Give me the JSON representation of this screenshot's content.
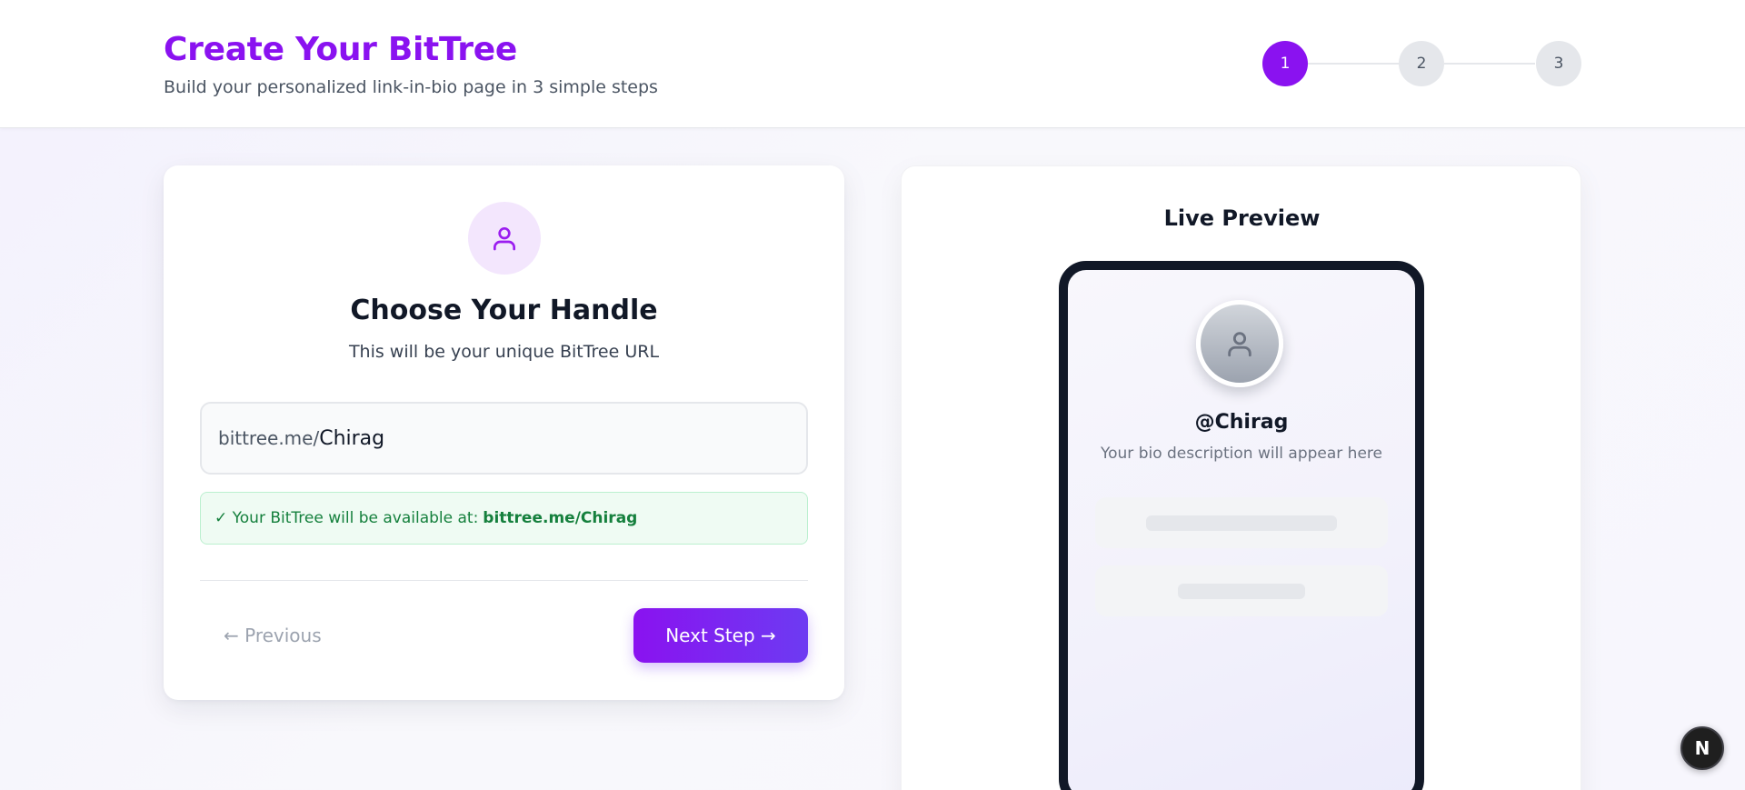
{
  "header": {
    "title": "Create Your BitTree",
    "subtitle": "Build your personalized link-in-bio page in 3 simple steps"
  },
  "steps": [
    {
      "label": "1",
      "active": true
    },
    {
      "label": "2",
      "active": false
    },
    {
      "label": "3",
      "active": false
    }
  ],
  "form": {
    "icon": "user-icon",
    "title": "Choose Your Handle",
    "subtitle": "This will be your unique BitTree URL",
    "url_prefix": "bittree.me/",
    "handle_value": "Chirag",
    "availability_text": "✓ Your BitTree will be available at:",
    "availability_url": "bittree.me/Chirag",
    "prev_label": "← Previous",
    "next_label": "Next Step →"
  },
  "preview": {
    "title": "Live Preview",
    "avatar_icon": "user-icon",
    "handle": "@Chirag",
    "bio": "Your bio description will appear here"
  },
  "badge": {
    "label": "N"
  },
  "colors": {
    "accent": "#8a12f0",
    "accent_end": "#6d3bf2",
    "success": "#15803d"
  }
}
